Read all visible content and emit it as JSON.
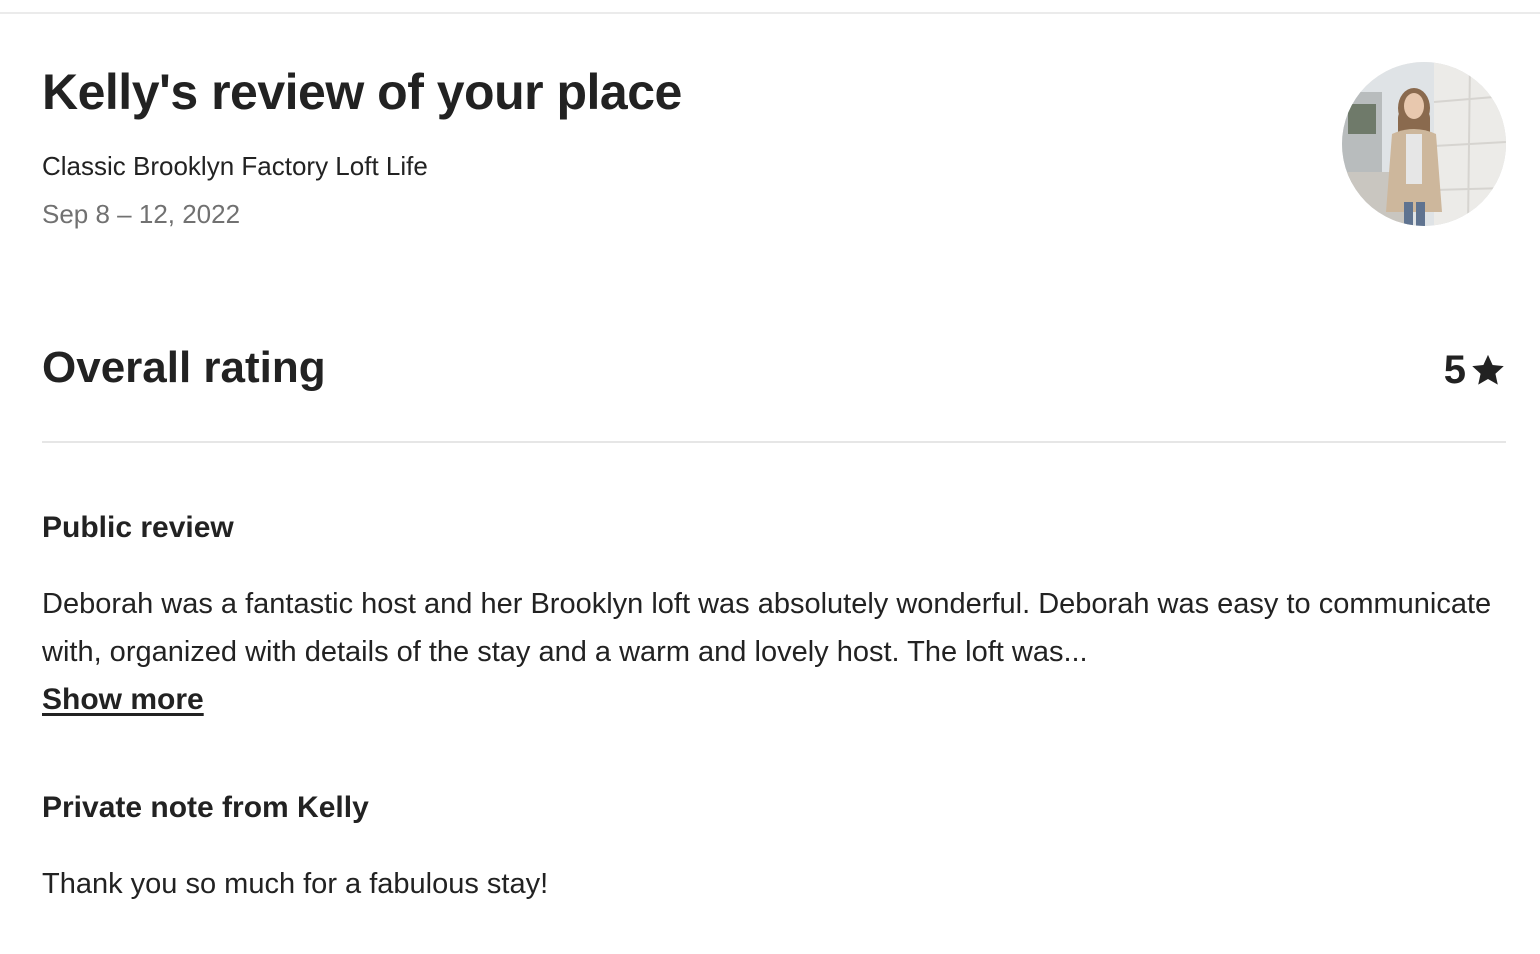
{
  "review": {
    "title": "Kelly's review of your place",
    "listing_name": "Classic Brooklyn Factory Loft Life",
    "dates": "Sep 8 – 12, 2022"
  },
  "reviewer": {
    "avatar_icon": "reviewer-avatar"
  },
  "rating": {
    "label": "Overall rating",
    "value": "5",
    "icon": "star-icon"
  },
  "public_review": {
    "heading": "Public review",
    "text": "Deborah was a fantastic host and her Brooklyn loft was absolutely wonderful. Deborah was easy to communicate with, organized with details of the stay and a warm and lovely host. The loft was...",
    "show_more_label": "Show more"
  },
  "private_note": {
    "heading": "Private note from Kelly",
    "text": "Thank you so much for a fabulous stay!"
  },
  "colors": {
    "text_primary": "#222222",
    "text_secondary": "#717171",
    "divider": "#e6e6e6"
  }
}
